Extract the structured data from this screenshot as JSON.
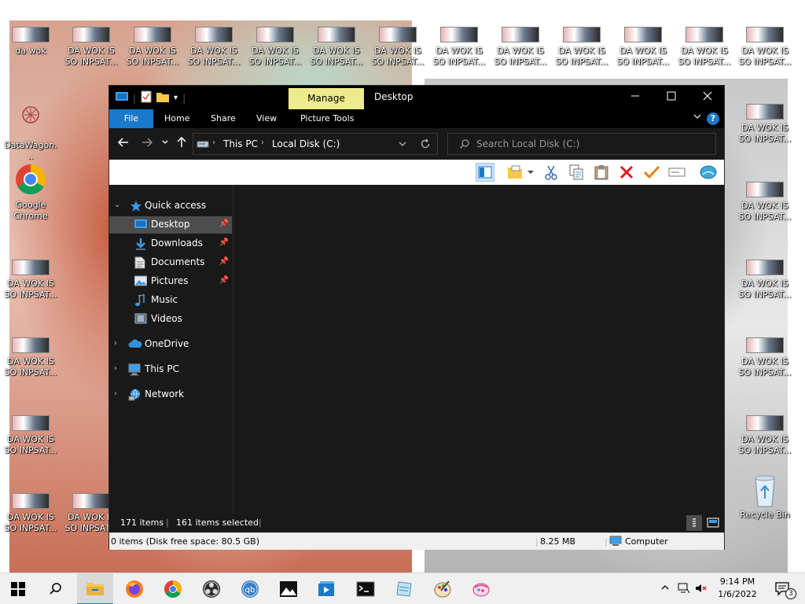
{
  "desktop": {
    "icon_short": "da wok",
    "icon_repeat": "DA WOK IS\nSO INPSAT...",
    "datawagon": "DataWagon...",
    "chrome": "Google\nChrome",
    "recycle_bin": "Recycle Bin"
  },
  "window": {
    "title": "Desktop",
    "manage_tab": "Manage",
    "ribbon_tabs": [
      "File",
      "Home",
      "Share",
      "View",
      "Picture Tools"
    ],
    "help": "?"
  },
  "address": {
    "segments": [
      "This PC",
      "Local Disk (C:)"
    ]
  },
  "search": {
    "placeholder": "Search Local Disk (C:)"
  },
  "navpane": {
    "quick_access": "Quick access",
    "items": [
      {
        "label": "Desktop",
        "pinned": true
      },
      {
        "label": "Downloads",
        "pinned": true
      },
      {
        "label": "Documents",
        "pinned": true
      },
      {
        "label": "Pictures",
        "pinned": true
      },
      {
        "label": "Music",
        "pinned": false
      },
      {
        "label": "Videos",
        "pinned": false
      }
    ],
    "onedrive": "OneDrive",
    "this_pc": "This PC",
    "network": "Network"
  },
  "status": {
    "item_count": "171 items",
    "selected_count": "161 items selected"
  },
  "details": {
    "free_space": "0 items (Disk free space: 80.5 GB)",
    "size": "8.25 MB",
    "location": "Computer"
  },
  "taskbar": {
    "time": "9:14 PM",
    "date": "1/6/2022",
    "notifications": "3"
  },
  "colors": {
    "accent": "#1979ca",
    "manage_tab": "#eeeb8e",
    "window_bg": "#191919"
  }
}
